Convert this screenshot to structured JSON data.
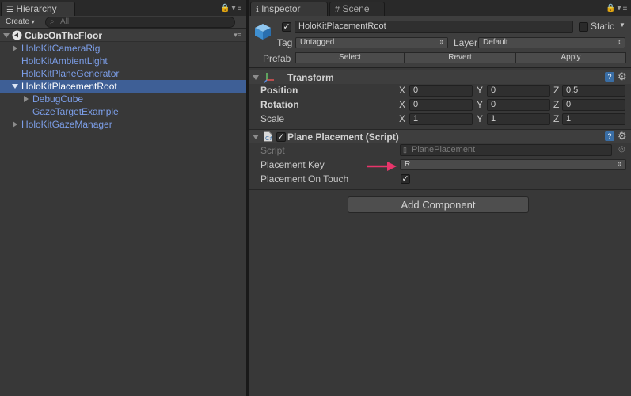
{
  "hierarchy": {
    "tab_label": "Hierarchy",
    "create_label": "Create",
    "search_placeholder": "All",
    "scene_name": "CubeOnTheFloor",
    "items": [
      {
        "label": "HoloKitCameraRig"
      },
      {
        "label": "HoloKitAmbientLight"
      },
      {
        "label": "HoloKitPlaneGenerator"
      },
      {
        "label": "HoloKitPlacementRoot"
      },
      {
        "label": "DebugCube"
      },
      {
        "label": "GazeTargetExample"
      },
      {
        "label": "HoloKitGazeManager"
      }
    ]
  },
  "inspector": {
    "tab_label": "Inspector",
    "scene_tab_label": "Scene",
    "object_name": "HoloKitPlacementRoot",
    "static_label": "Static",
    "tag_label": "Tag",
    "tag_value": "Untagged",
    "layer_label": "Layer",
    "layer_value": "Default",
    "prefab_label": "Prefab",
    "prefab_buttons": {
      "select": "Select",
      "revert": "Revert",
      "apply": "Apply"
    },
    "transform": {
      "title": "Transform",
      "position": {
        "label": "Position",
        "x": "0",
        "y": "0",
        "z": "0.5"
      },
      "rotation": {
        "label": "Rotation",
        "x": "0",
        "y": "0",
        "z": "0"
      },
      "scale": {
        "label": "Scale",
        "x": "1",
        "y": "1",
        "z": "1"
      },
      "axis": {
        "x": "X",
        "y": "Y",
        "z": "Z"
      }
    },
    "plane_placement": {
      "title": "Plane Placement (Script)",
      "script_label": "Script",
      "script_value": "PlanePlacement",
      "key_label": "Placement Key",
      "key_value": "R",
      "touch_label": "Placement On Touch"
    },
    "add_component_label": "Add Component"
  },
  "colors": {
    "selection": "#3e5f96",
    "prefab_text": "#7c9ee8",
    "annotation_arrow": "#e8356b"
  }
}
